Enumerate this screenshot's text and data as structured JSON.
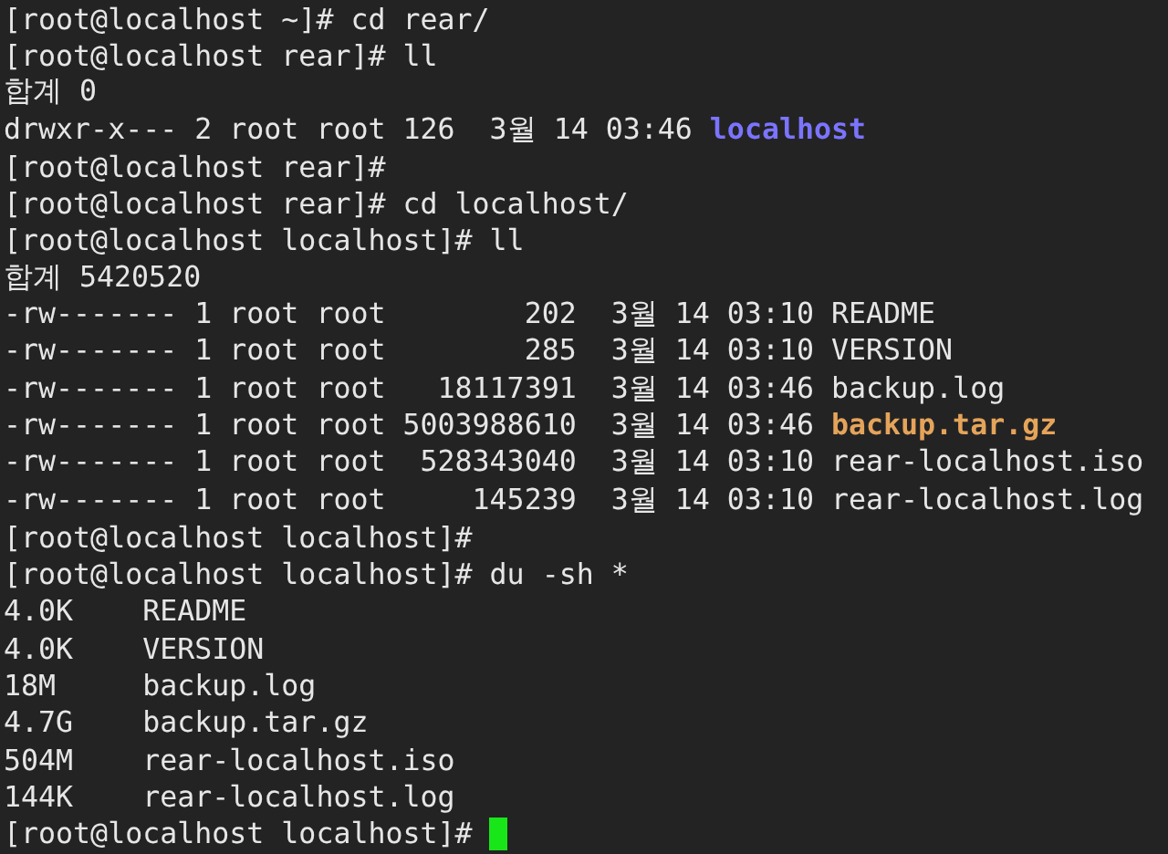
{
  "terminal": {
    "lines": [
      {
        "cursor": false,
        "segments": [
          {
            "kind": "plain",
            "text": "[root@localhost ~]# cd rear/"
          }
        ]
      },
      {
        "cursor": false,
        "segments": [
          {
            "kind": "plain",
            "text": "[root@localhost rear]# ll"
          }
        ]
      },
      {
        "cursor": false,
        "segments": [
          {
            "kind": "plain",
            "text": "합계 0"
          }
        ]
      },
      {
        "cursor": false,
        "segments": [
          {
            "kind": "plain",
            "text": "drwxr-x--- 2 root root 126  3월 14 03:46 "
          },
          {
            "kind": "directory",
            "text": "localhost"
          }
        ]
      },
      {
        "cursor": false,
        "segments": [
          {
            "kind": "plain",
            "text": "[root@localhost rear]#"
          }
        ]
      },
      {
        "cursor": false,
        "segments": [
          {
            "kind": "plain",
            "text": "[root@localhost rear]# cd localhost/"
          }
        ]
      },
      {
        "cursor": false,
        "segments": [
          {
            "kind": "plain",
            "text": "[root@localhost localhost]# ll"
          }
        ]
      },
      {
        "cursor": false,
        "segments": [
          {
            "kind": "plain",
            "text": "합계 5420520"
          }
        ]
      },
      {
        "cursor": false,
        "segments": [
          {
            "kind": "plain",
            "text": "-rw------- 1 root root        202  3월 14 03:10 README"
          }
        ]
      },
      {
        "cursor": false,
        "segments": [
          {
            "kind": "plain",
            "text": "-rw------- 1 root root        285  3월 14 03:10 VERSION"
          }
        ]
      },
      {
        "cursor": false,
        "segments": [
          {
            "kind": "plain",
            "text": "-rw------- 1 root root   18117391  3월 14 03:46 backup.log"
          }
        ]
      },
      {
        "cursor": false,
        "segments": [
          {
            "kind": "plain",
            "text": "-rw------- 1 root root 5003988610  3월 14 03:46 "
          },
          {
            "kind": "archive",
            "text": "backup.tar.gz"
          }
        ]
      },
      {
        "cursor": false,
        "segments": [
          {
            "kind": "plain",
            "text": "-rw------- 1 root root  528343040  3월 14 03:10 rear-localhost.iso"
          }
        ]
      },
      {
        "cursor": false,
        "segments": [
          {
            "kind": "plain",
            "text": "-rw------- 1 root root     145239  3월 14 03:10 rear-localhost.log"
          }
        ]
      },
      {
        "cursor": false,
        "segments": [
          {
            "kind": "plain",
            "text": "[root@localhost localhost]#"
          }
        ]
      },
      {
        "cursor": false,
        "segments": [
          {
            "kind": "plain",
            "text": "[root@localhost localhost]# du -sh *"
          }
        ]
      },
      {
        "cursor": false,
        "segments": [
          {
            "kind": "plain",
            "text": "4.0K    README"
          }
        ]
      },
      {
        "cursor": false,
        "segments": [
          {
            "kind": "plain",
            "text": "4.0K    VERSION"
          }
        ]
      },
      {
        "cursor": false,
        "segments": [
          {
            "kind": "plain",
            "text": "18M     backup.log"
          }
        ]
      },
      {
        "cursor": false,
        "segments": [
          {
            "kind": "plain",
            "text": "4.7G    backup.tar.gz"
          }
        ]
      },
      {
        "cursor": false,
        "segments": [
          {
            "kind": "plain",
            "text": "504M    rear-localhost.iso"
          }
        ]
      },
      {
        "cursor": false,
        "segments": [
          {
            "kind": "plain",
            "text": "144K    rear-localhost.log"
          }
        ]
      },
      {
        "cursor": true,
        "segments": [
          {
            "kind": "plain",
            "text": "[root@localhost localhost]# "
          }
        ]
      }
    ]
  }
}
